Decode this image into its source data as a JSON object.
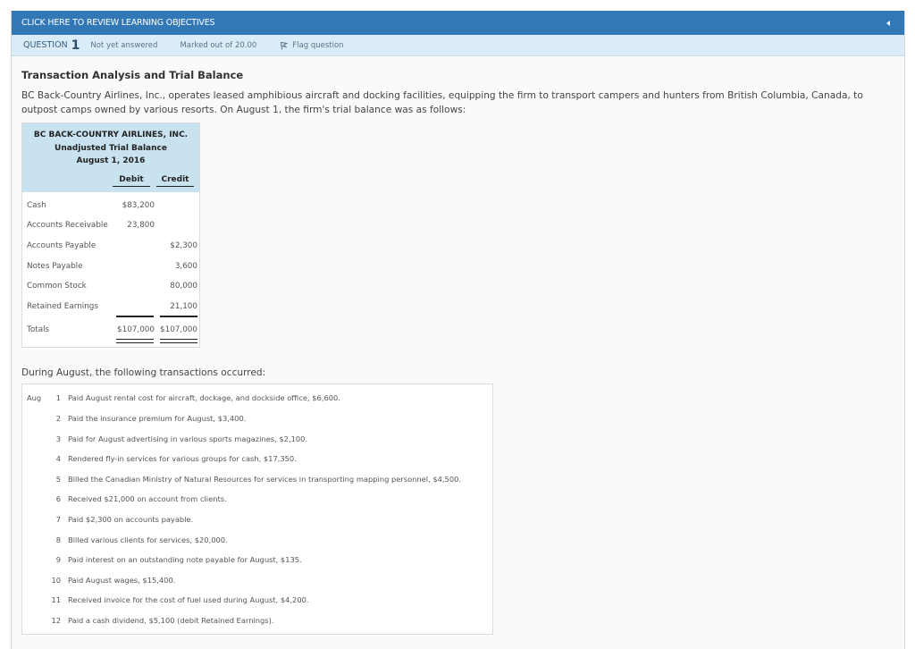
{
  "header": {
    "learning_objectives": "CLICK HERE TO REVIEW LEARNING OBJECTIVES"
  },
  "question_bar": {
    "question_word": "QUESTION",
    "question_number": "1",
    "status": "Not yet answered",
    "marked_out_of": "Marked out of 20.00",
    "flag_label": "Flag question"
  },
  "problem": {
    "title": "Transaction Analysis and Trial Balance",
    "intro": "BC Back-Country Airlines, Inc., operates leased amphibious aircraft and docking facilities, equipping the firm to transport campers and hunters from British Columbia, Canada, to outpost camps owned by various resorts. On August 1, the firm's trial balance was as follows:",
    "trial_balance": {
      "company": "BC BACK-COUNTRY AIRLINES, INC.",
      "statement": "Unadjusted Trial Balance",
      "date": "August 1, 2016",
      "col_debit": "Debit",
      "col_credit": "Credit",
      "rows": [
        {
          "account": "Cash",
          "debit": "$83,200",
          "credit": ""
        },
        {
          "account": "Accounts Receivable",
          "debit": "23,800",
          "credit": ""
        },
        {
          "account": "Accounts Payable",
          "debit": "",
          "credit": "$2,300"
        },
        {
          "account": "Notes Payable",
          "debit": "",
          "credit": "3,600"
        },
        {
          "account": "Common Stock",
          "debit": "",
          "credit": "80,000"
        },
        {
          "account": "Retained Earnings",
          "debit": "",
          "credit": "21,100"
        }
      ],
      "totals": {
        "label": "Totals",
        "debit": "$107,000",
        "credit": "$107,000"
      }
    },
    "transactions_intro": "During August, the following transactions occurred:",
    "transactions_month": "Aug",
    "transactions": [
      {
        "day": "1",
        "text": "Paid August rental cost for aircraft, dockage, and dockside office, $6,600."
      },
      {
        "day": "2",
        "text": "Paid the insurance premium for August, $3,400."
      },
      {
        "day": "3",
        "text": "Paid for August advertising in various sports magazines, $2,100."
      },
      {
        "day": "4",
        "text": "Rendered fly-in services for various groups for cash, $17,350."
      },
      {
        "day": "5",
        "text": "Billed the Canadian Ministry of Natural Resources for services in transporting mapping personnel, $4,500."
      },
      {
        "day": "6",
        "text": "Received $21,000 on account from clients."
      },
      {
        "day": "7",
        "text": "Paid $2,300 on accounts payable."
      },
      {
        "day": "8",
        "text": "Billed various clients for services, $20,000."
      },
      {
        "day": "9",
        "text": "Paid interest on an outstanding note payable for August, $135."
      },
      {
        "day": "10",
        "text": "Paid August wages, $15,400."
      },
      {
        "day": "11",
        "text": "Received invoice for the cost of fuel used during August, $4,200."
      },
      {
        "day": "12",
        "text": "Paid a cash dividend, $5,100 (debit Retained Earnings)."
      }
    ]
  },
  "colors": {
    "header_blue": "#3277b6",
    "question_bar_bg": "#d9ecf7",
    "table_header_bg": "#c9e2ef"
  }
}
